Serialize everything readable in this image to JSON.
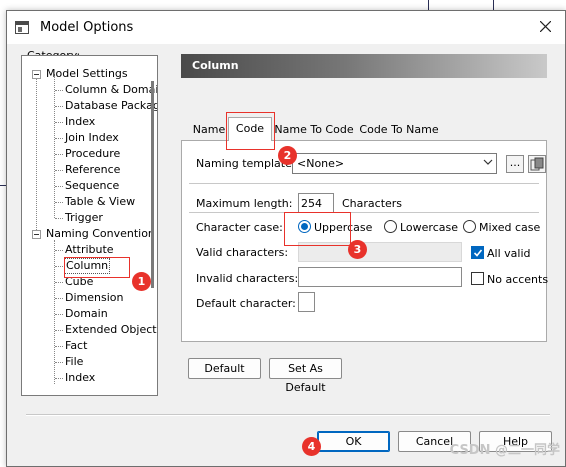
{
  "window": {
    "title": "Model Options"
  },
  "category_label": "Category:",
  "tree": {
    "model_settings": {
      "label": "Model Settings",
      "children": [
        "Column & Domain",
        "Database Packag",
        "Index",
        "Join Index",
        "Procedure",
        "Reference",
        "Sequence",
        "Table & View",
        "Trigger"
      ]
    },
    "naming_convention": {
      "label": "Naming Convention",
      "children": [
        "Attribute",
        "Column",
        "Cube",
        "Dimension",
        "Domain",
        "Extended Object",
        "Fact",
        "File",
        "Index"
      ],
      "selected": "Column"
    }
  },
  "panel": {
    "title": "Column"
  },
  "tabs": [
    {
      "label": "Name",
      "active": false
    },
    {
      "label": "Code",
      "active": true
    },
    {
      "label": "Name To Code",
      "active": false
    },
    {
      "label": "Code To Name",
      "active": false
    }
  ],
  "naming_template": {
    "label": "Naming template:",
    "value": "<None>",
    "more_label": "..."
  },
  "max_length": {
    "label": "Maximum length:",
    "value": "254",
    "unit": "Characters"
  },
  "character_case": {
    "label": "Character case:",
    "options": [
      "Uppercase",
      "Lowercase",
      "Mixed case"
    ],
    "selected": "Uppercase"
  },
  "valid_characters": {
    "label": "Valid characters:",
    "value": "",
    "all_valid_label": "All valid",
    "all_valid_checked": true
  },
  "invalid_characters": {
    "label": "Invalid characters:",
    "value": "",
    "no_accents_label": "No accents",
    "no_accents_checked": false
  },
  "default_character": {
    "label": "Default character:",
    "value": ""
  },
  "buttons": {
    "default": "Default",
    "set_as_default": "Set As Default",
    "ok": "OK",
    "cancel": "Cancel",
    "help": "Help"
  },
  "annotations": [
    "1",
    "2",
    "3",
    "4"
  ],
  "watermark": "CSDN @二一同学",
  "colors": {
    "accent": "#0067c0",
    "annotation": "#e8322b"
  }
}
